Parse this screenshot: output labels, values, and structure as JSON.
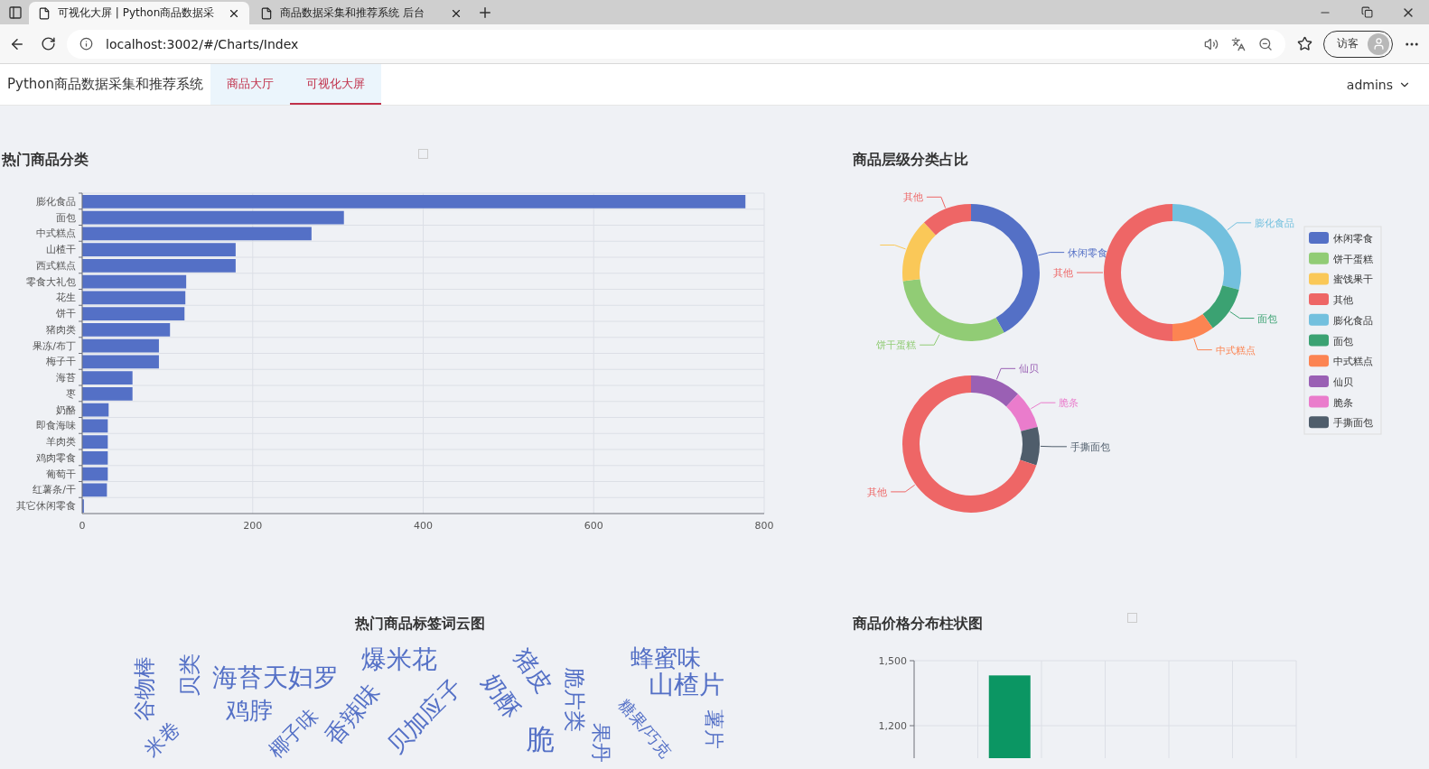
{
  "browser": {
    "tabs": [
      {
        "title": "可视化大屏 | Python商品数据采",
        "selected": true
      },
      {
        "title": "商品数据采集和推荐系统 后台",
        "selected": false
      }
    ],
    "address": "localhost:3002/#/Charts/Index",
    "profile": "访客"
  },
  "nav": {
    "brand": "Python商品数据采集和推荐系统",
    "items": [
      {
        "label": "商品大厅",
        "selected": false
      },
      {
        "label": "可视化大屏",
        "selected": true
      }
    ],
    "user": "admins"
  },
  "category_chart": {
    "title": "热门商品分类",
    "chart_data": {
      "type": "bar",
      "orientation": "horizontal",
      "categories": [
        "膨化食品",
        "面包",
        "中式糕点",
        "山楂干",
        "西式糕点",
        "零食大礼包",
        "花生",
        "饼干",
        "猪肉类",
        "果冻/布丁",
        "梅子干",
        "海苔",
        "枣",
        "奶酪",
        "即食海味",
        "羊肉类",
        "鸡肉零食",
        "葡萄干",
        "红薯条/干",
        "其它休闲零食"
      ],
      "series": [
        {
          "color": "#5470c6",
          "values": [
            778,
            307,
            269,
            180,
            180,
            122,
            121,
            120,
            103,
            90,
            90,
            59,
            59,
            31,
            30,
            30,
            30,
            30,
            29,
            2
          ]
        }
      ],
      "xlim": [
        0,
        800
      ],
      "xticks": [
        0,
        200,
        400,
        600,
        800
      ],
      "grid": true
    }
  },
  "level_share": {
    "title": "商品层级分类占比",
    "donuts": [
      {
        "chart_data": {
          "type": "donut",
          "values": [
            42,
            31,
            15,
            12
          ],
          "colors": [
            "#5470c6",
            "#91cc75",
            "#fac858",
            "#ee6666"
          ],
          "value_labels": [
            "休闲零食",
            "饼干蛋糕",
            null,
            "其他"
          ]
        }
      },
      {
        "chart_data": {
          "type": "donut",
          "values": [
            29,
            11,
            10,
            50
          ],
          "colors": [
            "#73c0de",
            "#3ba272",
            "#fc8452",
            "#ee6666"
          ],
          "value_labels": [
            "膨化食品",
            "面包",
            "中式糕点",
            "其他"
          ]
        }
      },
      {
        "chart_data": {
          "type": "donut",
          "values": [
            12,
            9,
            9,
            70
          ],
          "colors": [
            "#9a60b4",
            "#ea7ccc",
            "#4f5d6b",
            "#ee6666"
          ],
          "value_labels": [
            "仙贝",
            "脆条",
            "手撕面包",
            "其他"
          ]
        }
      }
    ],
    "legend": [
      {
        "label": "休闲零食",
        "color": "#5470c6"
      },
      {
        "label": "饼干蛋糕",
        "color": "#91cc75"
      },
      {
        "label": "蜜饯果干",
        "color": "#fac858"
      },
      {
        "label": "其他",
        "color": "#ee6666"
      },
      {
        "label": "膨化食品",
        "color": "#73c0de"
      },
      {
        "label": "面包",
        "color": "#3ba272"
      },
      {
        "label": "中式糕点",
        "color": "#fc8452"
      },
      {
        "label": "仙贝",
        "color": "#9a60b4"
      },
      {
        "label": "脆条",
        "color": "#ea7ccc"
      },
      {
        "label": "手撕面包",
        "color": "#4f5d6b"
      }
    ]
  },
  "tag_cloud": {
    "title": "热门商品标签词云图",
    "words": [
      "谷物棒",
      "贝类",
      "海苔天妇罗",
      "鸡脖",
      "爆米花",
      "香辣味",
      "椰子味",
      "米卷",
      "贝加应子",
      "奶酥",
      "猪皮",
      "脆片类",
      "蜂蜜味",
      "山楂片",
      "糖果/巧克",
      "薯片",
      "果丹",
      "脆"
    ]
  },
  "price_chart": {
    "title": "商品价格分布柱状图",
    "chart_data": {
      "type": "bar",
      "series": [
        {
          "color": "#0b9663",
          "values": [
            null,
            1432,
            null,
            null,
            null,
            null
          ]
        }
      ],
      "ylim": [
        1050,
        1500
      ],
      "yticks": [
        {
          "value": 1200,
          "label": "1,200"
        },
        {
          "value": 1500,
          "label": "1,500"
        }
      ],
      "grid": true
    }
  }
}
